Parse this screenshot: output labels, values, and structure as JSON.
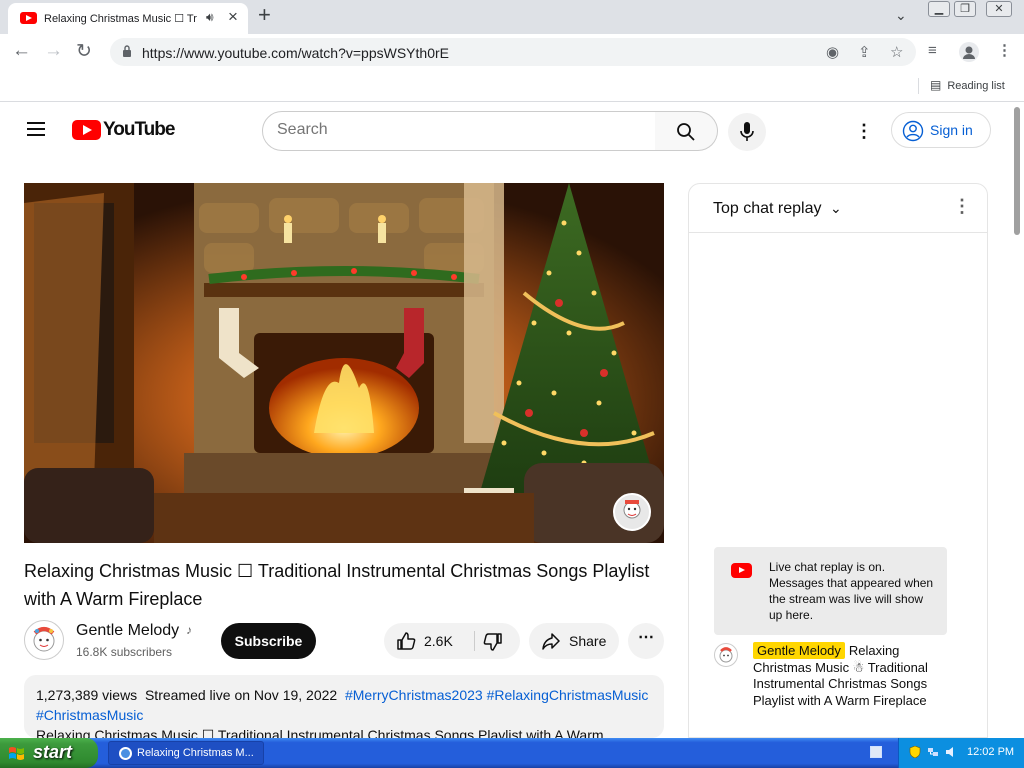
{
  "browser": {
    "tab_title": "Relaxing Christmas Music ☐ Tr",
    "url": "https://www.youtube.com/watch?v=ppsWSYth0rE",
    "reading_list_label": "Reading list"
  },
  "youtube": {
    "logo_text": "YouTube",
    "search_placeholder": "Search",
    "signin_label": "Sign in"
  },
  "video": {
    "title": "Relaxing Christmas Music ☐ Traditional Instrumental Christmas Songs Playlist with A Warm Fireplace",
    "channel_name": "Gentle Melody",
    "channel_note_glyph": "♪",
    "channel_subscribers": "16.8K subscribers",
    "subscribe_label": "Subscribe",
    "like_count": "2.6K",
    "share_label": "Share",
    "views": "1,273,389 views",
    "streamed_date": "Streamed live on Nov 19, 2022",
    "hashtags": [
      "#MerryChristmas2023",
      "#RelaxingChristmasMusic",
      "#ChristmasMusic"
    ],
    "description_line": "Relaxing Christmas Music ☐ Traditional Instrumental Christmas Songs Playlist with A Warm"
  },
  "chat": {
    "title": "Top chat replay",
    "notice": "Live chat replay is on. Messages that appeared when the stream was live will show up here.",
    "message_author": "Gentle Melody",
    "message_text": "Relaxing Christmas Music ☃ Traditional Instrumental Christmas Songs Playlist with A Warm Fireplace"
  },
  "taskbar": {
    "start_label": "start",
    "task_label": "Relaxing Christmas M...",
    "clock": "12:02 PM"
  },
  "colors": {
    "youtube_red": "#ff0000",
    "link_blue": "#065fd4",
    "chat_highlight": "#ffd600",
    "xp_blue": "#245edb",
    "xp_green": "#3c9a3c"
  }
}
